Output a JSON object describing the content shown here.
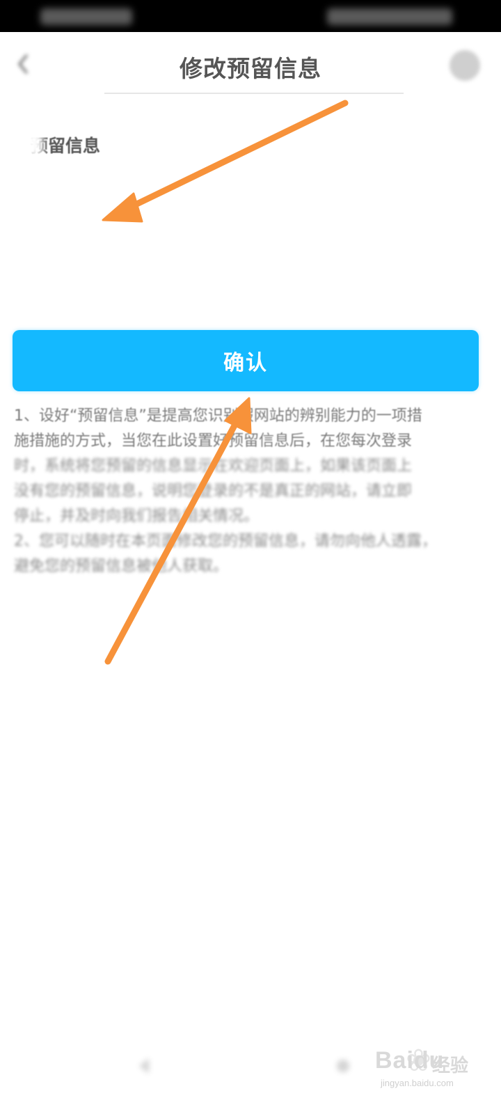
{
  "nav": {
    "title": "修改预留信息"
  },
  "section": {
    "label": "预留信息"
  },
  "confirm": {
    "label": "确认"
  },
  "description": {
    "line1": "1、设好“预留信息”是提高您识别假网站的辨别能力的一项措",
    "line2": "施措施的方式，当您在此设置好预留信息后，在您每次登录",
    "line3": "时，系统将您预留的信息显示在欢迎页面上，如果该页面上",
    "line4": "没有您的预留信息，说明您登录的不是真正的网站，请立即",
    "line5": "停止，并及时向我们报告相关情况。",
    "line6": "2、您可以随时在本页面修改您的预留信息，请勿向他人透露，",
    "line7": "避免您的预留信息被他人获取。"
  },
  "watermark": {
    "brand": "Baidu",
    "brand_cn": "经验",
    "url": "jingyan.baidu.com"
  },
  "colors": {
    "accent": "#14b9ff",
    "annotation_arrow": "#f7923a"
  },
  "icons": {
    "back": "chevron-left-icon",
    "help": "help-icon",
    "paw": "paw-icon"
  }
}
